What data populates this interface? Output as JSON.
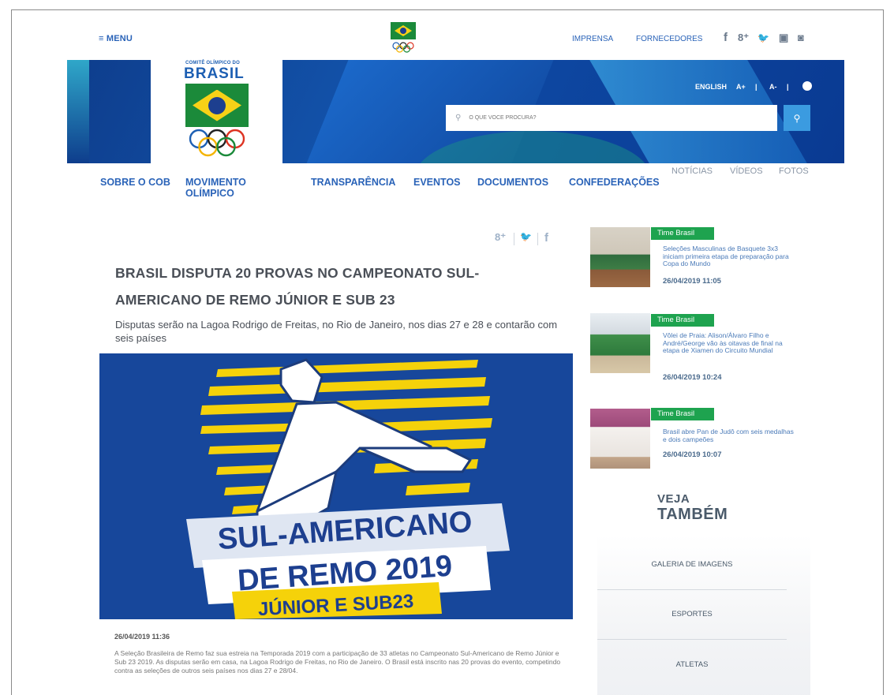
{
  "header": {
    "menu_label": "≡ MENU",
    "links": [
      "IMPRENSA",
      "FORNECEDORES"
    ],
    "social_icons": [
      "facebook-icon",
      "google-plus-icon",
      "twitter-icon",
      "youtube-icon",
      "instagram-icon"
    ],
    "social_glyphs": [
      "f",
      "8⁺",
      "🐦",
      "▣",
      "◙"
    ]
  },
  "logo": {
    "small_text": "COMITÊ OLÍMPICO DO",
    "brand_text": "BRASIL"
  },
  "accessibility": {
    "english": "ENGLISH",
    "font_plus": "A+",
    "font_minus": "A-",
    "divider": "|"
  },
  "search": {
    "placeholder": "O QUE VOCÊ PROCURA?"
  },
  "nav": {
    "items": [
      "SOBRE O COB",
      "MOVIMENTO\nOLÍMPICO",
      "TRANSPARÊNCIA",
      "EVENTOS",
      "DOCUMENTOS",
      "CONFEDERAÇÕES"
    ],
    "sub": [
      "NOTÍCIAS",
      "VÍDEOS",
      "FOTOS"
    ]
  },
  "article": {
    "share_glyphs": [
      "8⁺",
      "🐦",
      "f"
    ],
    "title": "BRASIL DISPUTA 20 PROVAS NO CAMPEONATO SUL-AMERICANO DE REMO JÚNIOR E SUB 23",
    "subtitle": "Disputas serão na Lagoa Rodrigo de Freitas, no Rio de Janeiro, nos dias 27 e 28 e contarão com seis países",
    "hero": {
      "line1": "SUL-AMERICANO",
      "line2": "DE REMO 2019",
      "line3": "JÚNIOR E SUB23"
    },
    "date": "26/04/2019 11:36",
    "body": "A Seleção Brasileira de Remo faz sua estreia na Temporada 2019 com a participação de 33 atletas no Campeonato Sul-Americano de Remo Júnior e Sub 23 2019. As disputas serão em casa, na Lagoa Rodrigo de Freitas, no Rio de Janeiro. O Brasil está inscrito nas 20 provas do evento, competindo contra as seleções de outros seis países nos dias 27 e 28/04."
  },
  "sidebar": {
    "news": [
      {
        "tag": "Time Brasil",
        "text": "Seleções Masculinas de Basquete 3x3 iniciam primeira etapa de preparação para Copa do Mundo",
        "date": "26/04/2019 11:05"
      },
      {
        "tag": "Time Brasil",
        "text": "Vôlei de Praia: Alison/Álvaro Filho e André/George vão às oitavas de final na etapa de Xiamen do Circuito Mundial",
        "date": "26/04/2019 10:24"
      },
      {
        "tag": "Time Brasil",
        "text": "Brasil abre Pan de Judô com seis medalhas e dois campeões",
        "date": "26/04/2019 10:07"
      }
    ],
    "veja": "VEJA",
    "tambem": "TAMBÉM",
    "links": [
      "GALERIA DE IMAGENS",
      "ESPORTES",
      "ATLETAS"
    ]
  },
  "colors": {
    "brand_blue": "#2a63b8",
    "banner_blue": "#0e3d8c",
    "tag_green": "#1ea34f",
    "hero_yellow": "#f5d20a"
  }
}
